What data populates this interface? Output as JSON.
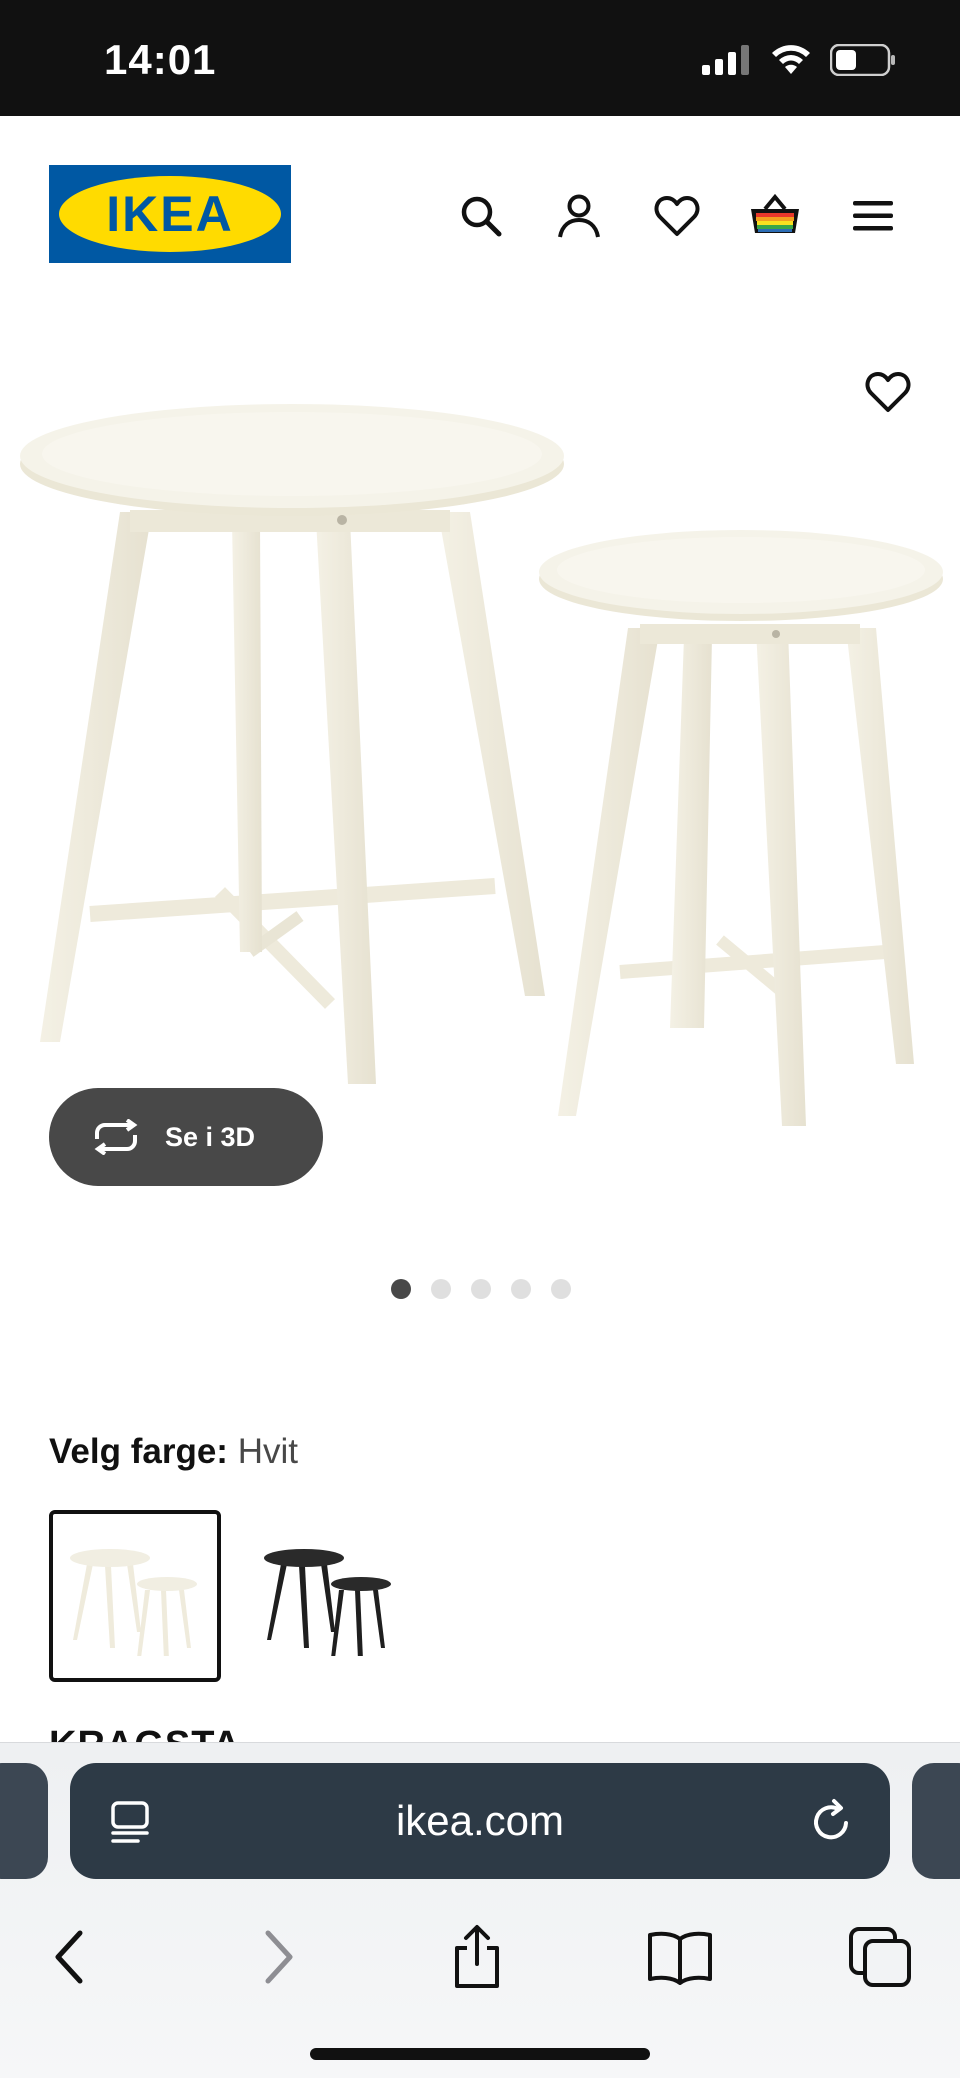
{
  "status_bar": {
    "time": "14:01"
  },
  "header": {
    "logo_text": "IKEA",
    "icons": [
      "search-icon",
      "account-icon",
      "favourites-icon",
      "basket-icon",
      "menu-icon"
    ]
  },
  "product": {
    "view_3d_label": "Se i 3D",
    "carousel": {
      "total": 5,
      "active": 1
    },
    "favourite_icon": "heart-icon"
  },
  "color_picker": {
    "label": "Velg farge:",
    "selected_value": "Hvit",
    "options": [
      "Hvit",
      "Svart"
    ]
  },
  "product_name": "KRAGSTA",
  "browser": {
    "url": "ikea.com",
    "toolbar": [
      "back-icon",
      "forward-icon",
      "share-icon",
      "bookmarks-icon",
      "tabs-icon"
    ]
  },
  "colors": {
    "ikea_blue": "#0058a3",
    "ikea_yellow": "#ffdb00",
    "dark_button": "#484848",
    "url_bar": "#2d3a46"
  }
}
